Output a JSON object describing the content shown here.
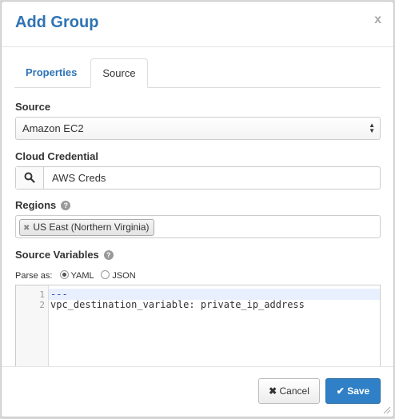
{
  "dialog": {
    "title": "Add Group",
    "close_glyph": "x"
  },
  "tabs": [
    {
      "label": "Properties",
      "active": false
    },
    {
      "label": "Source",
      "active": true
    }
  ],
  "source": {
    "label": "Source",
    "selected": "Amazon EC2"
  },
  "credential": {
    "label": "Cloud Credential",
    "value": "AWS Creds",
    "button_icon": "search-icon"
  },
  "regions": {
    "label": "Regions",
    "chips": [
      "US East (Northern Virginia)"
    ]
  },
  "source_vars": {
    "label": "Source Variables",
    "parse_label": "Parse as:",
    "options": [
      "YAML",
      "JSON"
    ],
    "selected": "YAML",
    "lines": [
      {
        "num": "1",
        "text": "---"
      },
      {
        "num": "2",
        "text": "vpc_destination_variable: private_ip_address"
      }
    ]
  },
  "footer": {
    "cancel_label": "Cancel",
    "save_label": "Save"
  },
  "colors": {
    "accent": "#2f73b4",
    "primary_button": "#2f80c6"
  }
}
